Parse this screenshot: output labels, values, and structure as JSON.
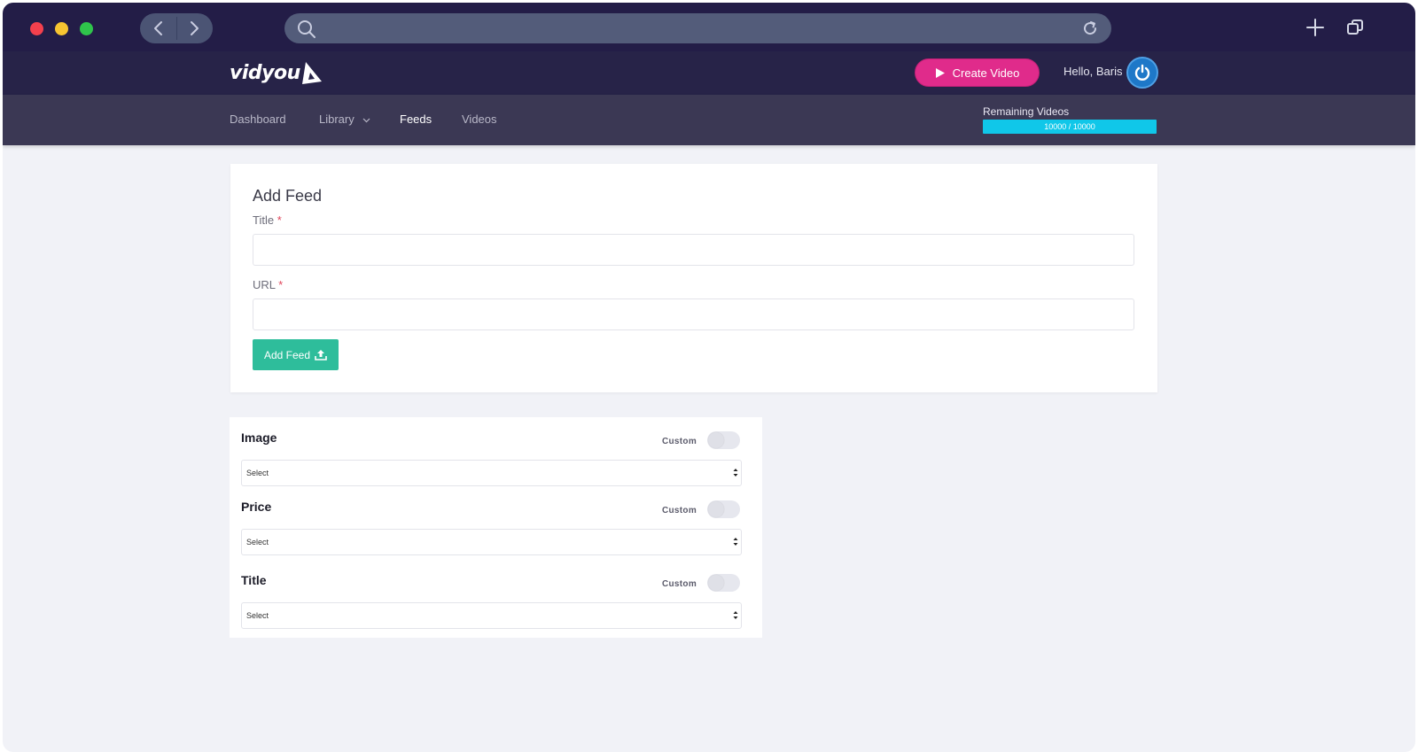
{
  "browser": {
    "url": ""
  },
  "app": {
    "logo": "vidyou",
    "create_button": "Create Video",
    "greeting": "Hello, Baris",
    "accent": "#e02b8b"
  },
  "nav": {
    "items": [
      {
        "label": "Dashboard"
      },
      {
        "label": "Library"
      },
      {
        "label": "Feeds"
      },
      {
        "label": "Videos"
      }
    ],
    "active": "Feeds",
    "remaining": {
      "label": "Remaining Videos",
      "value": "10000 / 10000",
      "fraction": 1.0
    }
  },
  "form": {
    "title": "Add Feed",
    "title_label": "Title",
    "url_label": "URL",
    "required_mark": "*",
    "title_value": "",
    "url_value": "",
    "submit": "Add Feed"
  },
  "mapping": {
    "custom_label": "Custom",
    "rows": [
      {
        "label": "Image",
        "selected": "Select"
      },
      {
        "label": "Price",
        "selected": "Select"
      },
      {
        "label": "Title",
        "selected": "Select"
      }
    ]
  }
}
